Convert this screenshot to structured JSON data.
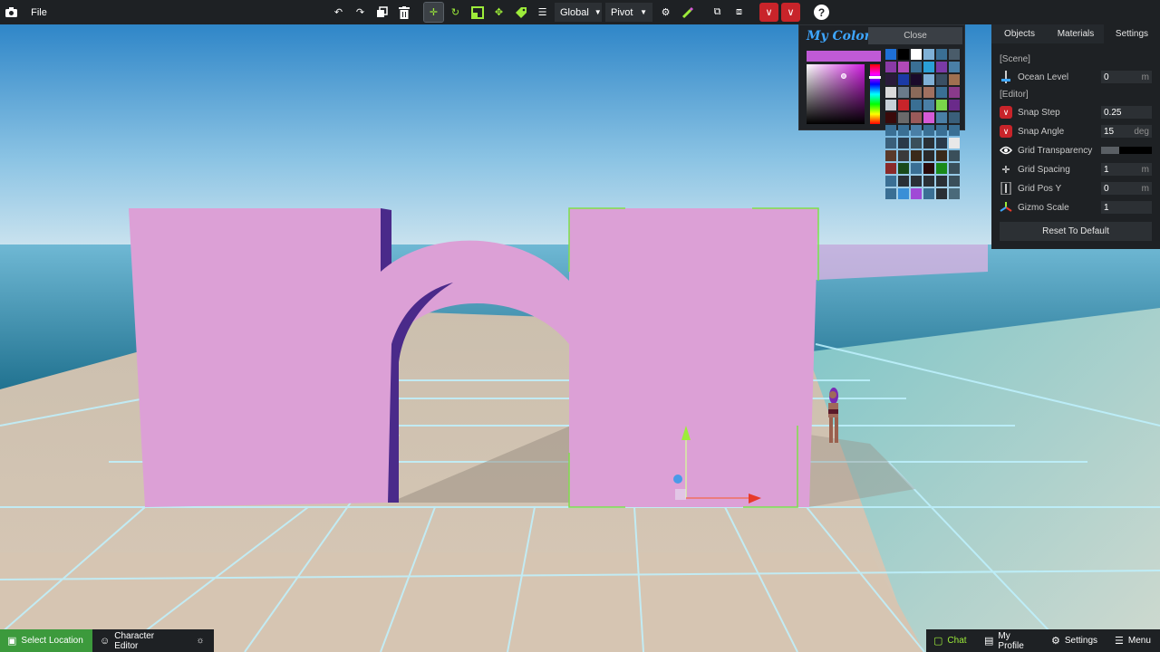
{
  "toolbar": {
    "file_label": "File",
    "space_mode": "Global",
    "pivot_mode": "Pivot",
    "help_label": "?"
  },
  "color_picker": {
    "title": "My Colors",
    "close_label": "Close",
    "current_color": "#c05ad6",
    "swatches": [
      "#1e6fd6",
      "#000000",
      "#ffffff",
      "#7fb0d6",
      "#3a6f94",
      "#4a5c6a",
      "#8a3aa6",
      "#b04ab8",
      "#3a6f94",
      "#2a9fd6",
      "#7a3aa6",
      "#4a7fa6",
      "#2a1a3a",
      "#1a3aa6",
      "#1a0a2a",
      "#7fb0d6",
      "#3a4f64",
      "#a07050",
      "#dadada",
      "#6a7a8a",
      "#8a6a5a",
      "#a07060",
      "#3a6f94",
      "#8a3a8a",
      "#c8d0d8",
      "#c8242a",
      "#3a6f94",
      "#4a7fa6",
      "#7ad64a",
      "#6a2a8a",
      "#3a0a0a",
      "#6a6a6a",
      "#9a5a5a",
      "#d65ad6",
      "#4a7fa6",
      "#3a5f7a",
      "#3a6f94",
      "#3a6f94",
      "#4a7fa6",
      "#3a6f94",
      "#3a6f94",
      "#3a6f94",
      "#3a5f7a",
      "#2a3a4a",
      "#3a4f5a",
      "#2a3036",
      "#2a3a4a",
      "#e8e8e8",
      "#5a3a2a",
      "#3a3a3a",
      "#3a2a1a",
      "#2a2a2a",
      "#3a2a1a",
      "#3a4f5a",
      "#8a2a2a",
      "#1a4a1a",
      "#3a6f94",
      "#2a0a0a",
      "#1a8a1a",
      "#3a4f5a",
      "#3a6f94",
      "#2a3036",
      "#2a3036",
      "#2a3036",
      "#2a3036",
      "#3a4f5a",
      "#3a6f94",
      "#3a8fd6",
      "#a04ad6",
      "#3a6f94",
      "#2a3036",
      "#4a6a7a"
    ]
  },
  "panel": {
    "tabs": [
      "Objects",
      "Materials",
      "Settings"
    ],
    "active_tab": "Settings",
    "scene_section": "[Scene]",
    "editor_section": "[Editor]",
    "ocean_level": {
      "label": "Ocean Level",
      "value": "0",
      "unit": "m"
    },
    "snap_step": {
      "label": "Snap Step",
      "value": "0.25",
      "unit": ""
    },
    "snap_angle": {
      "label": "Snap Angle",
      "value": "15",
      "unit": "deg"
    },
    "grid_transparency": {
      "label": "Grid Transparency",
      "value": 0.35
    },
    "grid_spacing": {
      "label": "Grid Spacing",
      "value": "1",
      "unit": "m"
    },
    "grid_pos_y": {
      "label": "Grid Pos Y",
      "value": "0",
      "unit": "m"
    },
    "gizmo_scale": {
      "label": "Gizmo Scale",
      "value": "1",
      "unit": ""
    },
    "reset_label": "Reset To Default"
  },
  "bottom": {
    "select_location": "Select Location",
    "character_editor": "Character Editor",
    "chat": "Chat",
    "my_profile": "My Profile",
    "settings": "Settings",
    "menu": "Menu"
  },
  "colors": {
    "wall": "#dca0d6",
    "wall_shadow": "#4a2a8a",
    "selection": "#7ee04a",
    "accent_red": "#c8242a",
    "accent_green": "#9dec3a"
  }
}
